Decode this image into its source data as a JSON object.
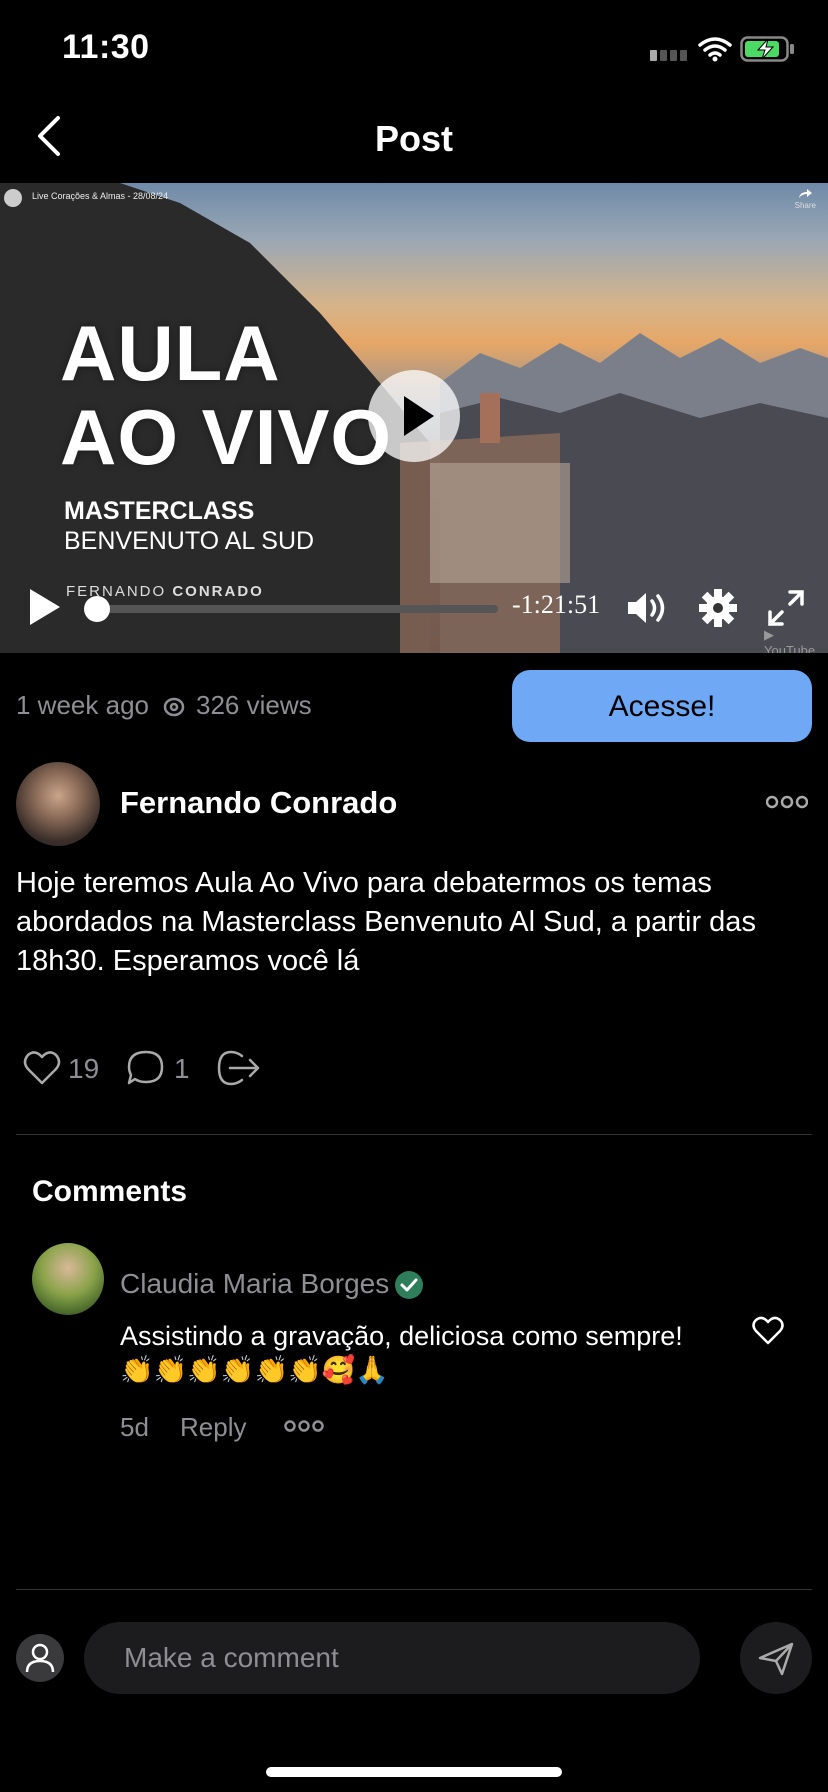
{
  "status_bar": {
    "time": "11:30",
    "icons": [
      "signal-icon",
      "wifi-icon",
      "battery-charging-icon"
    ]
  },
  "header": {
    "title": "Post",
    "back_icon": "chevron-left-icon"
  },
  "video": {
    "channel_title": "Live Corações & Almas - 28/08/24",
    "share_label": "Share",
    "headline_line1": "AULA",
    "headline_line2": "AO VIVO",
    "subtitle1": "MASTERCLASS",
    "subtitle2": "BENVENUTO AL SUD",
    "author_first": "FERNANDO",
    "author_last": "CONRADO",
    "time_remaining": "-1:21:51",
    "progress": 0.0,
    "brand": "YouTube"
  },
  "meta": {
    "posted": "1 week ago",
    "views": "326 views",
    "cta_label": "Acesse!"
  },
  "author": {
    "name": "Fernando Conrado"
  },
  "post": {
    "text": "Hoje teremos Aula Ao Vivo para debatermos os temas abordados na Masterclass Benvenuto Al Sud, a partir das 18h30. Esperamos você lá"
  },
  "actions": {
    "likes": "19",
    "comments": "1"
  },
  "comments": {
    "heading": "Comments",
    "items": [
      {
        "name": "Claudia Maria Borges",
        "verified": true,
        "text": "Assistindo a gravação, deliciosa como sempre!",
        "emojis": "👏👏👏👏👏👏🥰🙏",
        "age": "5d",
        "reply_label": "Reply"
      }
    ]
  },
  "composer": {
    "placeholder": "Make a comment"
  },
  "colors": {
    "accent": "#6fa8f5",
    "background": "#000000",
    "muted": "#8e8e93",
    "verified": "#2e7d5b"
  }
}
